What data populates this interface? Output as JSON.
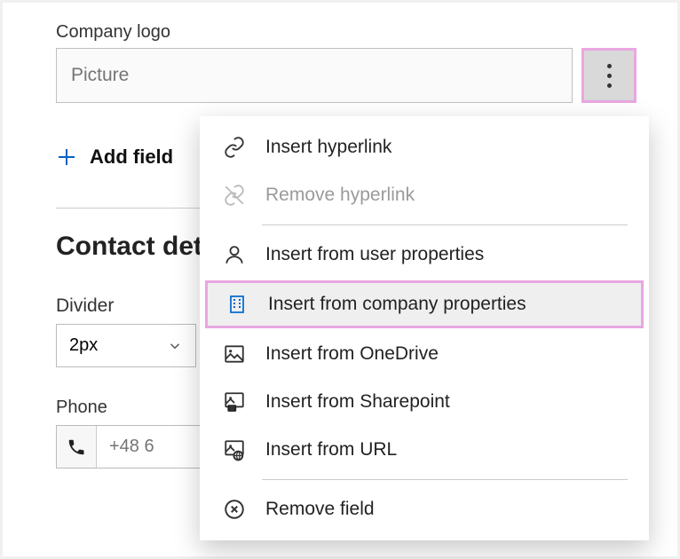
{
  "field": {
    "label": "Company logo",
    "picture_placeholder": "Picture"
  },
  "add_field_label": "Add field",
  "section_title": "Contact details",
  "divider": {
    "label": "Divider",
    "value": "2px"
  },
  "phone": {
    "label": "Phone",
    "placeholder": "+48 6"
  },
  "menu": {
    "insert_hyperlink": "Insert hyperlink",
    "remove_hyperlink": "Remove hyperlink",
    "insert_user": "Insert from user properties",
    "insert_company": "Insert from company properties",
    "insert_onedrive": "Insert from OneDrive",
    "insert_sharepoint": "Insert from Sharepoint",
    "insert_url": "Insert from URL",
    "remove_field": "Remove field"
  }
}
